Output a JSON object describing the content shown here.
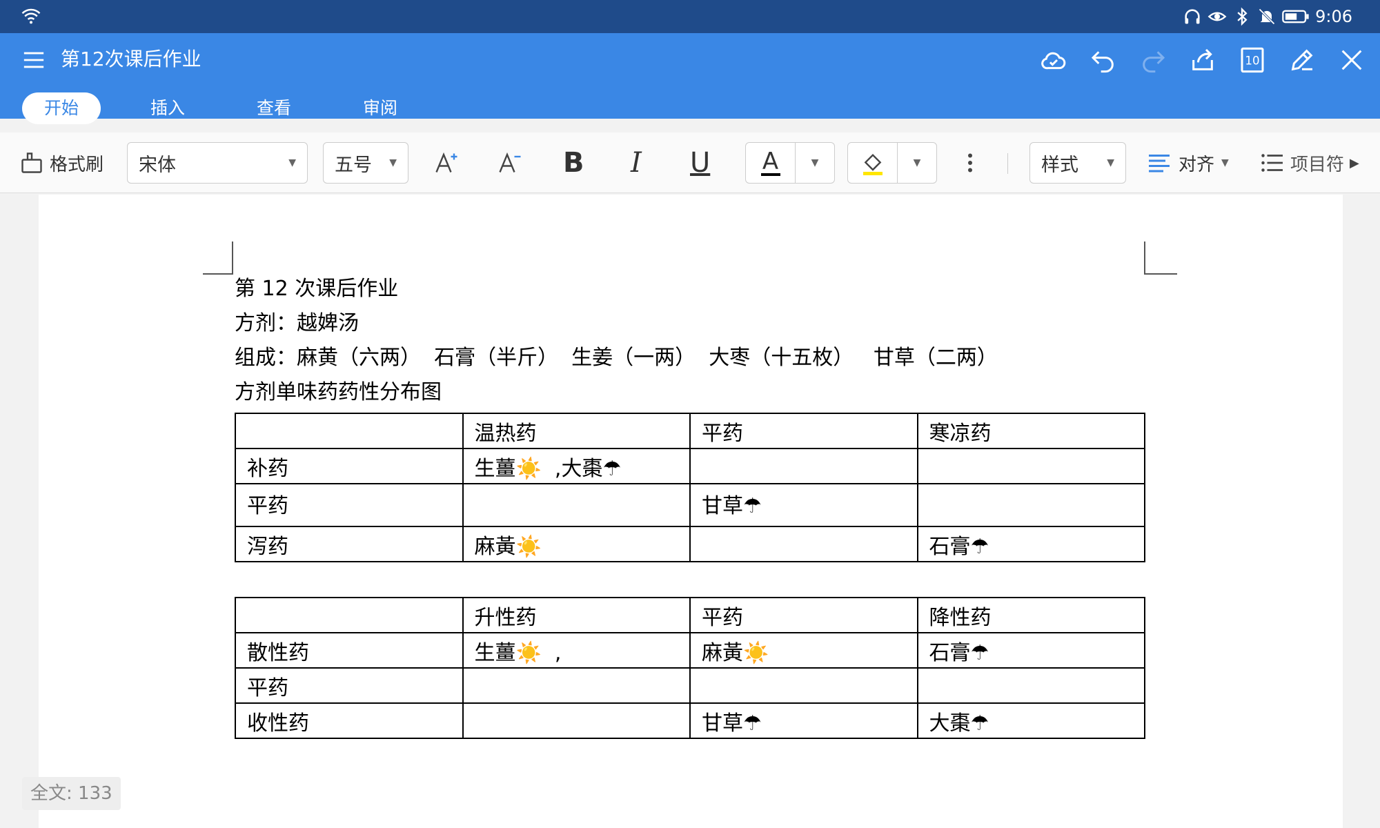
{
  "status": {
    "time": "9:06"
  },
  "app": {
    "title": "第12次课后作业",
    "tabs": [
      {
        "label": "开始",
        "active": true
      },
      {
        "label": "插入",
        "active": false
      },
      {
        "label": "查看",
        "active": false
      },
      {
        "label": "审阅",
        "active": false
      }
    ],
    "page_count_badge": "10"
  },
  "toolbar": {
    "format_painter": "格式刷",
    "font_name": "宋体",
    "font_size": "五号",
    "bold": "B",
    "italic": "I",
    "underline": "U",
    "font_color_glyph": "A",
    "style": "样式",
    "align": "对齐",
    "bullets": "项目符"
  },
  "doc": {
    "line1": "第 12 次课后作业",
    "line2": "方剂：越婢汤",
    "line3": "组成：麻黄（六两）  石膏（半斤）  生姜（一两）  大枣（十五枚）   甘草（二两）",
    "line4": "方剂单味药药性分布图",
    "table1": {
      "header": [
        "",
        "温热药",
        "平药",
        "寒凉药"
      ],
      "rows": [
        [
          "补药",
          "生薑☀️  ,大棗☂",
          "",
          ""
        ],
        [
          "平药",
          "",
          "甘草☂",
          ""
        ],
        [
          "泻药",
          "麻黃☀️",
          "",
          "石膏☂"
        ]
      ]
    },
    "table2": {
      "header": [
        "",
        "升性药",
        "平药",
        "降性药"
      ],
      "rows": [
        [
          "散性药",
          "生薑☀️  ,",
          "麻黃☀️",
          "石膏☂"
        ],
        [
          "平药",
          "",
          "",
          ""
        ],
        [
          "收性药",
          "",
          "甘草☂",
          "大棗☂"
        ]
      ]
    }
  },
  "footer": {
    "word_count": "全文: 133"
  },
  "colors": {
    "statusbar": "#1f4b8a",
    "titlebar": "#3a87e5",
    "highlight": "#ffe600"
  }
}
